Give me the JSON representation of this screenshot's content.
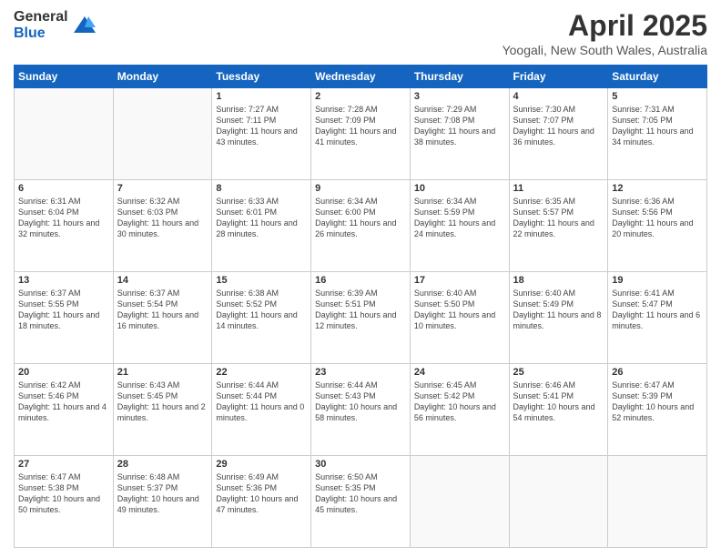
{
  "logo": {
    "general": "General",
    "blue": "Blue"
  },
  "header": {
    "month": "April 2025",
    "location": "Yoogali, New South Wales, Australia"
  },
  "weekdays": [
    "Sunday",
    "Monday",
    "Tuesday",
    "Wednesday",
    "Thursday",
    "Friday",
    "Saturday"
  ],
  "weeks": [
    [
      null,
      null,
      {
        "day": 1,
        "sunrise": "Sunrise: 7:27 AM",
        "sunset": "Sunset: 7:11 PM",
        "daylight": "Daylight: 11 hours and 43 minutes."
      },
      {
        "day": 2,
        "sunrise": "Sunrise: 7:28 AM",
        "sunset": "Sunset: 7:09 PM",
        "daylight": "Daylight: 11 hours and 41 minutes."
      },
      {
        "day": 3,
        "sunrise": "Sunrise: 7:29 AM",
        "sunset": "Sunset: 7:08 PM",
        "daylight": "Daylight: 11 hours and 38 minutes."
      },
      {
        "day": 4,
        "sunrise": "Sunrise: 7:30 AM",
        "sunset": "Sunset: 7:07 PM",
        "daylight": "Daylight: 11 hours and 36 minutes."
      },
      {
        "day": 5,
        "sunrise": "Sunrise: 7:31 AM",
        "sunset": "Sunset: 7:05 PM",
        "daylight": "Daylight: 11 hours and 34 minutes."
      }
    ],
    [
      {
        "day": 6,
        "sunrise": "Sunrise: 6:31 AM",
        "sunset": "Sunset: 6:04 PM",
        "daylight": "Daylight: 11 hours and 32 minutes."
      },
      {
        "day": 7,
        "sunrise": "Sunrise: 6:32 AM",
        "sunset": "Sunset: 6:03 PM",
        "daylight": "Daylight: 11 hours and 30 minutes."
      },
      {
        "day": 8,
        "sunrise": "Sunrise: 6:33 AM",
        "sunset": "Sunset: 6:01 PM",
        "daylight": "Daylight: 11 hours and 28 minutes."
      },
      {
        "day": 9,
        "sunrise": "Sunrise: 6:34 AM",
        "sunset": "Sunset: 6:00 PM",
        "daylight": "Daylight: 11 hours and 26 minutes."
      },
      {
        "day": 10,
        "sunrise": "Sunrise: 6:34 AM",
        "sunset": "Sunset: 5:59 PM",
        "daylight": "Daylight: 11 hours and 24 minutes."
      },
      {
        "day": 11,
        "sunrise": "Sunrise: 6:35 AM",
        "sunset": "Sunset: 5:57 PM",
        "daylight": "Daylight: 11 hours and 22 minutes."
      },
      {
        "day": 12,
        "sunrise": "Sunrise: 6:36 AM",
        "sunset": "Sunset: 5:56 PM",
        "daylight": "Daylight: 11 hours and 20 minutes."
      }
    ],
    [
      {
        "day": 13,
        "sunrise": "Sunrise: 6:37 AM",
        "sunset": "Sunset: 5:55 PM",
        "daylight": "Daylight: 11 hours and 18 minutes."
      },
      {
        "day": 14,
        "sunrise": "Sunrise: 6:37 AM",
        "sunset": "Sunset: 5:54 PM",
        "daylight": "Daylight: 11 hours and 16 minutes."
      },
      {
        "day": 15,
        "sunrise": "Sunrise: 6:38 AM",
        "sunset": "Sunset: 5:52 PM",
        "daylight": "Daylight: 11 hours and 14 minutes."
      },
      {
        "day": 16,
        "sunrise": "Sunrise: 6:39 AM",
        "sunset": "Sunset: 5:51 PM",
        "daylight": "Daylight: 11 hours and 12 minutes."
      },
      {
        "day": 17,
        "sunrise": "Sunrise: 6:40 AM",
        "sunset": "Sunset: 5:50 PM",
        "daylight": "Daylight: 11 hours and 10 minutes."
      },
      {
        "day": 18,
        "sunrise": "Sunrise: 6:40 AM",
        "sunset": "Sunset: 5:49 PM",
        "daylight": "Daylight: 11 hours and 8 minutes."
      },
      {
        "day": 19,
        "sunrise": "Sunrise: 6:41 AM",
        "sunset": "Sunset: 5:47 PM",
        "daylight": "Daylight: 11 hours and 6 minutes."
      }
    ],
    [
      {
        "day": 20,
        "sunrise": "Sunrise: 6:42 AM",
        "sunset": "Sunset: 5:46 PM",
        "daylight": "Daylight: 11 hours and 4 minutes."
      },
      {
        "day": 21,
        "sunrise": "Sunrise: 6:43 AM",
        "sunset": "Sunset: 5:45 PM",
        "daylight": "Daylight: 11 hours and 2 minutes."
      },
      {
        "day": 22,
        "sunrise": "Sunrise: 6:44 AM",
        "sunset": "Sunset: 5:44 PM",
        "daylight": "Daylight: 11 hours and 0 minutes."
      },
      {
        "day": 23,
        "sunrise": "Sunrise: 6:44 AM",
        "sunset": "Sunset: 5:43 PM",
        "daylight": "Daylight: 10 hours and 58 minutes."
      },
      {
        "day": 24,
        "sunrise": "Sunrise: 6:45 AM",
        "sunset": "Sunset: 5:42 PM",
        "daylight": "Daylight: 10 hours and 56 minutes."
      },
      {
        "day": 25,
        "sunrise": "Sunrise: 6:46 AM",
        "sunset": "Sunset: 5:41 PM",
        "daylight": "Daylight: 10 hours and 54 minutes."
      },
      {
        "day": 26,
        "sunrise": "Sunrise: 6:47 AM",
        "sunset": "Sunset: 5:39 PM",
        "daylight": "Daylight: 10 hours and 52 minutes."
      }
    ],
    [
      {
        "day": 27,
        "sunrise": "Sunrise: 6:47 AM",
        "sunset": "Sunset: 5:38 PM",
        "daylight": "Daylight: 10 hours and 50 minutes."
      },
      {
        "day": 28,
        "sunrise": "Sunrise: 6:48 AM",
        "sunset": "Sunset: 5:37 PM",
        "daylight": "Daylight: 10 hours and 49 minutes."
      },
      {
        "day": 29,
        "sunrise": "Sunrise: 6:49 AM",
        "sunset": "Sunset: 5:36 PM",
        "daylight": "Daylight: 10 hours and 47 minutes."
      },
      {
        "day": 30,
        "sunrise": "Sunrise: 6:50 AM",
        "sunset": "Sunset: 5:35 PM",
        "daylight": "Daylight: 10 hours and 45 minutes."
      },
      null,
      null,
      null
    ]
  ]
}
